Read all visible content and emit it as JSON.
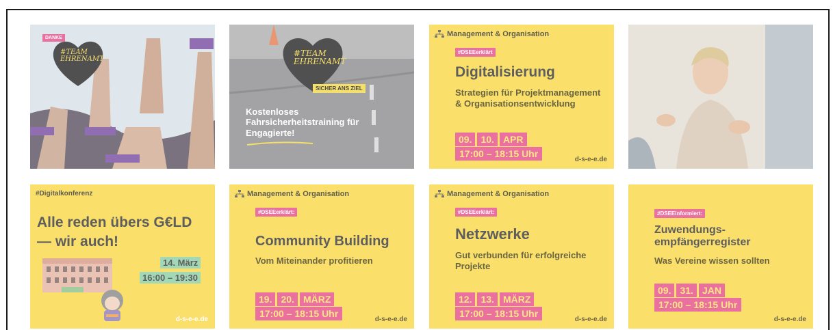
{
  "tiles": {
    "t1": {
      "badge": "DANKE",
      "heart_text": "#TEAM EHRENAMT"
    },
    "t2": {
      "heart_text": "#TEAM EHRENAMT",
      "sub_badge": "SICHER ANS ZIEL",
      "caption": "Kostenloses Fahrsicherheitstraining für Engagierte!"
    },
    "t3": {
      "category": "Management & Organisation",
      "tag": "#DSEEerklärt",
      "title": "Digitalisierung",
      "subtitle": "Strategien für Projektmanagement & Organisationsentwicklung",
      "dates": [
        "09.",
        "10.",
        "APR"
      ],
      "time": "17:00 – 18:15 Uhr",
      "domain": "d-s-e-e.de"
    },
    "t5": {
      "tag": "#Digitalkonferenz",
      "title_line1": "Alle reden übers G€LD",
      "title_line2": "— wir auch!",
      "date": "14. März",
      "time": "16:00 – 19:30",
      "domain": "d-s-e-e.de"
    },
    "t6": {
      "category": "Management & Organisation",
      "tag": "#DSEEerklärt:",
      "title": "Community Building",
      "subtitle": "Vom Miteinander profitieren",
      "dates": [
        "19.",
        "20.",
        "MÄRZ"
      ],
      "time": "17:00 – 18:15 Uhr",
      "domain": "d-s-e-e.de"
    },
    "t7": {
      "category": "Management & Organisation",
      "tag": "#DSEEerklärt:",
      "title": "Netzwerke",
      "subtitle": "Gut verbunden für erfolgreiche Projekte",
      "dates": [
        "12.",
        "13.",
        "MÄRZ"
      ],
      "time": "17:00 – 18:15 Uhr",
      "domain": "d-s-e-e.de"
    },
    "t8": {
      "tag": "#DSEEinformiert:",
      "title": "Zuwendungs-empfängerregister",
      "subtitle": "Was Vereine wissen sollten",
      "dates": [
        "09.",
        "31.",
        "JAN"
      ],
      "time": "17:00 – 18:15 Uhr",
      "domain": "d-s-e-e.de"
    }
  }
}
